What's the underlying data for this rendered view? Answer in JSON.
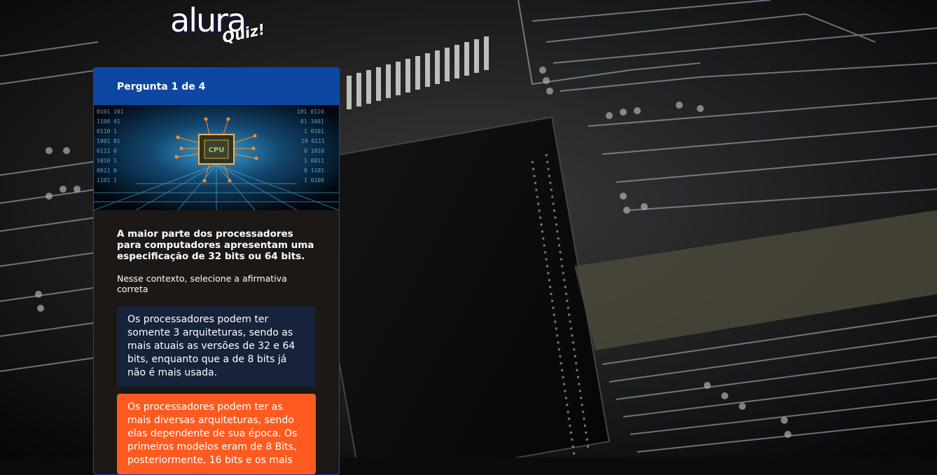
{
  "logo": {
    "brand": "alura",
    "product": "Quiz!"
  },
  "quiz": {
    "progress_label": "Pergunta 1 de 4",
    "question_title": "A maior parte dos processadores para computadores apresentam uma especificação de 32 bits ou 64 bits.",
    "question_description": "Nesse contexto, selecione a afirmativa correta",
    "answers": [
      {
        "text": "Os processadores podem ter somente 3 arquiteturas, sendo as mais atuais as versões de 32 e 64 bits, enquanto que a de 8 bits já não é mais usada."
      },
      {
        "text": "Os processadores podem ter as mais diversas arquiteturas, sendo elas dependente de sua época. Os primeiros modelos eram de 8 Bits, posteriormente, 16 bits e os mais"
      }
    ],
    "image_chip_label": "CPU"
  },
  "colors": {
    "header": "#0d47a1",
    "card_bg": "#1c1816",
    "answer_default": "#17233a",
    "answer_highlight": "#ff5a1f"
  }
}
